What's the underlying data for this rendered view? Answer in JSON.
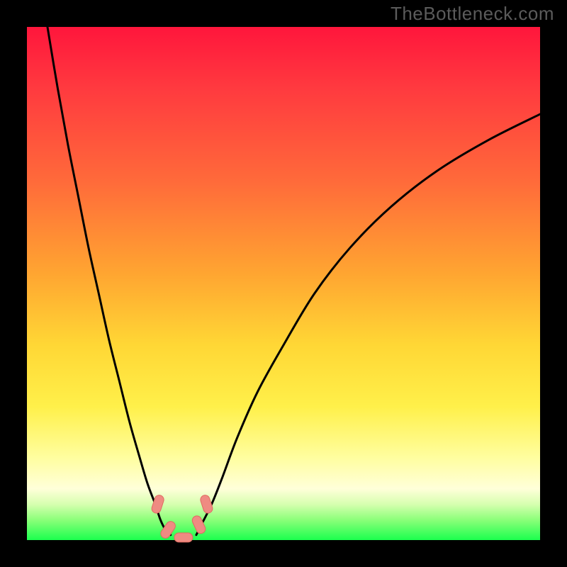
{
  "watermark": "TheBottleneck.com",
  "chart_data": {
    "type": "line",
    "title": "",
    "xlabel": "",
    "ylabel": "",
    "xlim": [
      0,
      100
    ],
    "ylim": [
      0,
      100
    ],
    "series": [
      {
        "name": "left-curve",
        "x": [
          4,
          6,
          8,
          10,
          12,
          14,
          16,
          18,
          20,
          22,
          23.5,
          25,
          26,
          27,
          28
        ],
        "values": [
          100,
          88,
          77,
          67,
          57,
          48,
          39,
          31,
          23,
          16,
          11,
          7,
          4,
          2,
          1
        ]
      },
      {
        "name": "right-curve",
        "x": [
          33,
          34,
          36,
          38,
          41,
          45,
          50,
          56,
          63,
          71,
          80,
          90,
          100
        ],
        "values": [
          1,
          3,
          7,
          12,
          20,
          29,
          38,
          48,
          57,
          65,
          72,
          78,
          83
        ]
      }
    ],
    "markers": [
      {
        "name": "marker-left-upper",
        "x": 25.5,
        "y": 7,
        "angle": -72
      },
      {
        "name": "marker-left-lower",
        "x": 27.5,
        "y": 2,
        "angle": -55
      },
      {
        "name": "marker-bottom",
        "x": 30.5,
        "y": 0.5,
        "angle": 0
      },
      {
        "name": "marker-right-lower",
        "x": 33.5,
        "y": 3,
        "angle": 65
      },
      {
        "name": "marker-right-upper",
        "x": 35.0,
        "y": 7,
        "angle": 72
      }
    ],
    "colors": {
      "curve": "#000000",
      "marker_fill": "#ef8b82",
      "marker_stroke": "#e06a60"
    }
  }
}
